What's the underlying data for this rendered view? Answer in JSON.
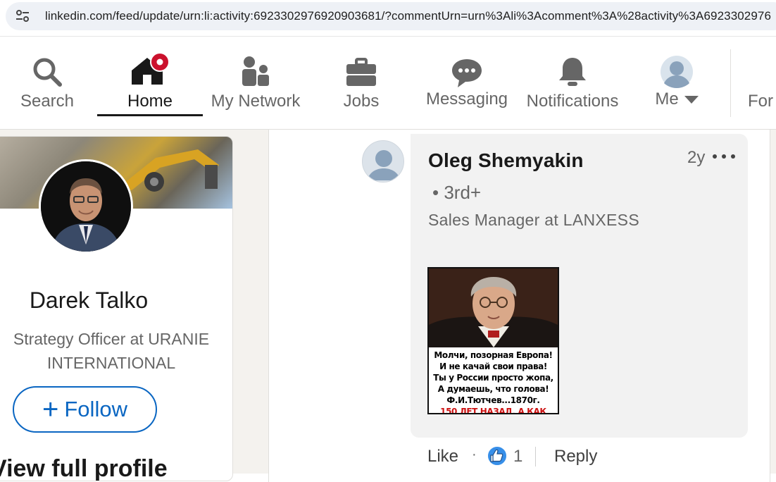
{
  "browser": {
    "url": "linkedin.com/feed/update/urn:li:activity:6923302976920903681/?commentUrn=urn%3Ali%3Acomment%3A%28activity%3A6923302976"
  },
  "nav": {
    "items": [
      {
        "label": "Search",
        "icon": "search-icon"
      },
      {
        "label": "Home",
        "icon": "home-icon",
        "active": true
      },
      {
        "label": "My Network",
        "icon": "network-icon"
      },
      {
        "label": "Jobs",
        "icon": "briefcase-icon"
      },
      {
        "label": "Messaging",
        "icon": "chat-icon"
      },
      {
        "label": "Notifications",
        "icon": "bell-icon"
      },
      {
        "label": "Me",
        "icon": "avatar-icon"
      },
      {
        "label": "For"
      }
    ],
    "home_badge_color": "#cb112d"
  },
  "profile": {
    "name": "Darek Talko",
    "headline_line1": "Strategy Officer at URANIE",
    "headline_line2": "INTERNATIONAL",
    "follow_label": "Follow",
    "view_full_profile": "View full profile"
  },
  "comment": {
    "author": "Oleg Shemyakin",
    "degree": "• 3rd+",
    "title": "Sales Manager at LANXESS",
    "time": "2y",
    "image_caption": [
      "Молчи, позорная Европа!",
      "И не качай свои права!",
      "Ты у России просто жопа,",
      "А думаешь, что голова!",
      "Ф.И.Тютчев...1870г.",
      "150 ЛЕТ НАЗАД, А КАК"
    ],
    "actions": {
      "like_label": "Like",
      "separator": "·",
      "reaction_count": "1",
      "reply_label": "Reply"
    }
  },
  "colors": {
    "accent": "#0a66c2",
    "reaction_blue": "#378fe9",
    "page_bg": "#f4f2ee",
    "bubble_bg": "#f2f2f2"
  }
}
